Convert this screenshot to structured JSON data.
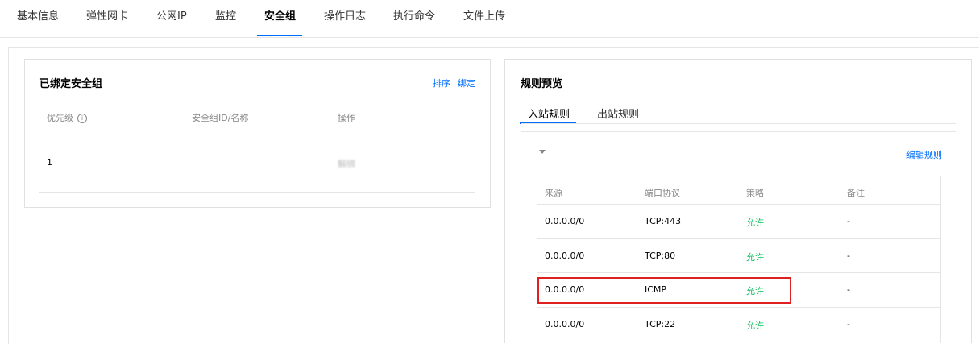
{
  "tabs": [
    {
      "label": "基本信息",
      "active": false
    },
    {
      "label": "弹性网卡",
      "active": false
    },
    {
      "label": "公网IP",
      "active": false
    },
    {
      "label": "监控",
      "active": false
    },
    {
      "label": "安全组",
      "active": true
    },
    {
      "label": "操作日志",
      "active": false
    },
    {
      "label": "执行命令",
      "active": false
    },
    {
      "label": "文件上传",
      "active": false
    }
  ],
  "bound_panel": {
    "title": "已绑定安全组",
    "actions": {
      "sort": "排序",
      "bind": "绑定"
    },
    "columns": {
      "priority": "优先级",
      "sg": "安全组ID/名称",
      "op": "操作"
    },
    "rows": [
      {
        "priority": "1",
        "sg_id": "",
        "sg_name": "",
        "op": "解绑"
      }
    ]
  },
  "preview_panel": {
    "title": "规则预览",
    "subtabs": [
      {
        "label": "入站规则",
        "active": true
      },
      {
        "label": "出站规则",
        "active": false
      }
    ],
    "group_header": "",
    "edit_label": "编辑规则",
    "columns": {
      "source": "来源",
      "port": "端口协议",
      "policy": "策略",
      "note": "备注"
    },
    "rows": [
      {
        "source": "0.0.0.0/0",
        "port": "TCP:443",
        "policy": "允许",
        "note": "-"
      },
      {
        "source": "0.0.0.0/0",
        "port": "TCP:80",
        "policy": "允许",
        "note": "-"
      },
      {
        "source": "0.0.0.0/0",
        "port": "ICMP",
        "policy": "允许",
        "note": "-",
        "highlighted": true
      },
      {
        "source": "0.0.0.0/0",
        "port": "TCP:22",
        "policy": "允许",
        "note": "-"
      }
    ]
  },
  "colors": {
    "accent": "#006eff",
    "allow": "#0abf5b",
    "highlight": "#e02020"
  }
}
